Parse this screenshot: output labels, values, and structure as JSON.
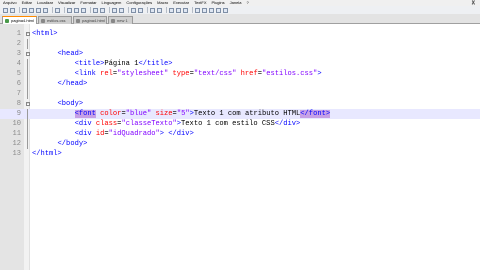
{
  "menu": [
    "Arquivo",
    "Editar",
    "Localizar",
    "Visualizar",
    "Formatar",
    "Linguagem",
    "Configurações",
    "Macro",
    "Executar",
    "TextFX",
    "Plugins",
    "Janela",
    "?"
  ],
  "window_close": "X",
  "toolbar_close": "X",
  "tabs": [
    {
      "label": "pagina4.html",
      "active": true
    },
    {
      "label": "estilos.css",
      "active": false
    },
    {
      "label": "pagina4.html",
      "active": false
    },
    {
      "label": "new 1",
      "active": false
    }
  ],
  "editor": {
    "lines": [
      {
        "num": "1",
        "fold": "minus",
        "segments": [
          {
            "t": "tag",
            "v": "<html>"
          }
        ]
      },
      {
        "num": "2",
        "fold": "line",
        "segments": []
      },
      {
        "num": "3",
        "fold": "minus",
        "segments": [
          {
            "t": "txt",
            "v": "      "
          },
          {
            "t": "tag",
            "v": "<head>"
          }
        ]
      },
      {
        "num": "4",
        "fold": "line",
        "segments": [
          {
            "t": "txt",
            "v": "          "
          },
          {
            "t": "tag",
            "v": "<title>"
          },
          {
            "t": "txt",
            "v": "Página 1"
          },
          {
            "t": "tag",
            "v": "</title>"
          }
        ]
      },
      {
        "num": "5",
        "fold": "line",
        "segments": [
          {
            "t": "txt",
            "v": "          "
          },
          {
            "t": "tag",
            "v": "<link "
          },
          {
            "t": "attr",
            "v": "rel"
          },
          {
            "t": "txt",
            "v": "="
          },
          {
            "t": "val",
            "v": "\"stylesheet\""
          },
          {
            "t": "txt",
            "v": " "
          },
          {
            "t": "attr",
            "v": "type"
          },
          {
            "t": "txt",
            "v": "="
          },
          {
            "t": "val",
            "v": "\"text/css\""
          },
          {
            "t": "txt",
            "v": " "
          },
          {
            "t": "attr",
            "v": "href"
          },
          {
            "t": "txt",
            "v": "="
          },
          {
            "t": "val",
            "v": "\"estilos.css\""
          },
          {
            "t": "tag",
            "v": ">"
          }
        ]
      },
      {
        "num": "6",
        "fold": "line",
        "segments": [
          {
            "t": "txt",
            "v": "      "
          },
          {
            "t": "tag",
            "v": "</head>"
          }
        ]
      },
      {
        "num": "7",
        "fold": "line",
        "segments": []
      },
      {
        "num": "8",
        "fold": "minus",
        "segments": [
          {
            "t": "txt",
            "v": "      "
          },
          {
            "t": "tag",
            "v": "<body>"
          }
        ]
      },
      {
        "num": "9",
        "fold": "line",
        "highlight": true,
        "segments": [
          {
            "t": "txt",
            "v": "          "
          },
          {
            "t": "tag bm",
            "v": "<font"
          },
          {
            "t": "txt",
            "v": " "
          },
          {
            "t": "attr",
            "v": "color"
          },
          {
            "t": "txt",
            "v": "="
          },
          {
            "t": "val",
            "v": "\"blue\""
          },
          {
            "t": "txt",
            "v": " "
          },
          {
            "t": "attr",
            "v": "size"
          },
          {
            "t": "txt",
            "v": "="
          },
          {
            "t": "val",
            "v": "\"5\""
          },
          {
            "t": "tag",
            "v": ">"
          },
          {
            "t": "txt",
            "v": "Texto 1 com atributo HTML"
          },
          {
            "t": "tag bm",
            "v": "</font>"
          }
        ]
      },
      {
        "num": "10",
        "fold": "line",
        "segments": [
          {
            "t": "txt",
            "v": "          "
          },
          {
            "t": "tag",
            "v": "<div "
          },
          {
            "t": "attr",
            "v": "class"
          },
          {
            "t": "txt",
            "v": "="
          },
          {
            "t": "val",
            "v": "\"classeTexto\""
          },
          {
            "t": "tag",
            "v": ">"
          },
          {
            "t": "txt",
            "v": "Texto 1 com estilo CSS"
          },
          {
            "t": "tag",
            "v": "</div>"
          }
        ]
      },
      {
        "num": "11",
        "fold": "line",
        "segments": [
          {
            "t": "txt",
            "v": "          "
          },
          {
            "t": "tag",
            "v": "<div "
          },
          {
            "t": "attr",
            "v": "id"
          },
          {
            "t": "txt",
            "v": "="
          },
          {
            "t": "val",
            "v": "\"idQuadrado\""
          },
          {
            "t": "tag",
            "v": ">"
          },
          {
            "t": "txt",
            "v": " "
          },
          {
            "t": "tag",
            "v": "</div>"
          }
        ]
      },
      {
        "num": "12",
        "fold": "line",
        "segments": [
          {
            "t": "txt",
            "v": "      "
          },
          {
            "t": "tag",
            "v": "</body>"
          }
        ]
      },
      {
        "num": "13",
        "fold": "line",
        "segments": [
          {
            "t": "tag",
            "v": "</html>"
          }
        ]
      }
    ]
  },
  "colors": {
    "tag": "#0000ff",
    "attr": "#ff0000",
    "value": "#8000ff",
    "brace_match": "#c7a0e6",
    "current_line": "#e8e8ff",
    "active_tab_accent": "#ff8a00"
  },
  "icons": [
    "new-file-icon",
    "open-icon",
    "save-icon",
    "save-all-icon",
    "close-icon",
    "close-all-icon",
    "print-icon",
    "cut-icon",
    "copy-icon",
    "paste-icon",
    "undo-icon",
    "redo-icon",
    "find-icon",
    "replace-icon",
    "zoom-in-icon",
    "zoom-out-icon",
    "sync-vertical-icon",
    "sync-horizontal-icon",
    "word-wrap-icon",
    "show-all-chars-icon",
    "indent-guide-icon",
    "macro-record-icon",
    "macro-stop-icon",
    "macro-play-icon",
    "macro-run-multiple-icon",
    "macro-save-icon"
  ]
}
